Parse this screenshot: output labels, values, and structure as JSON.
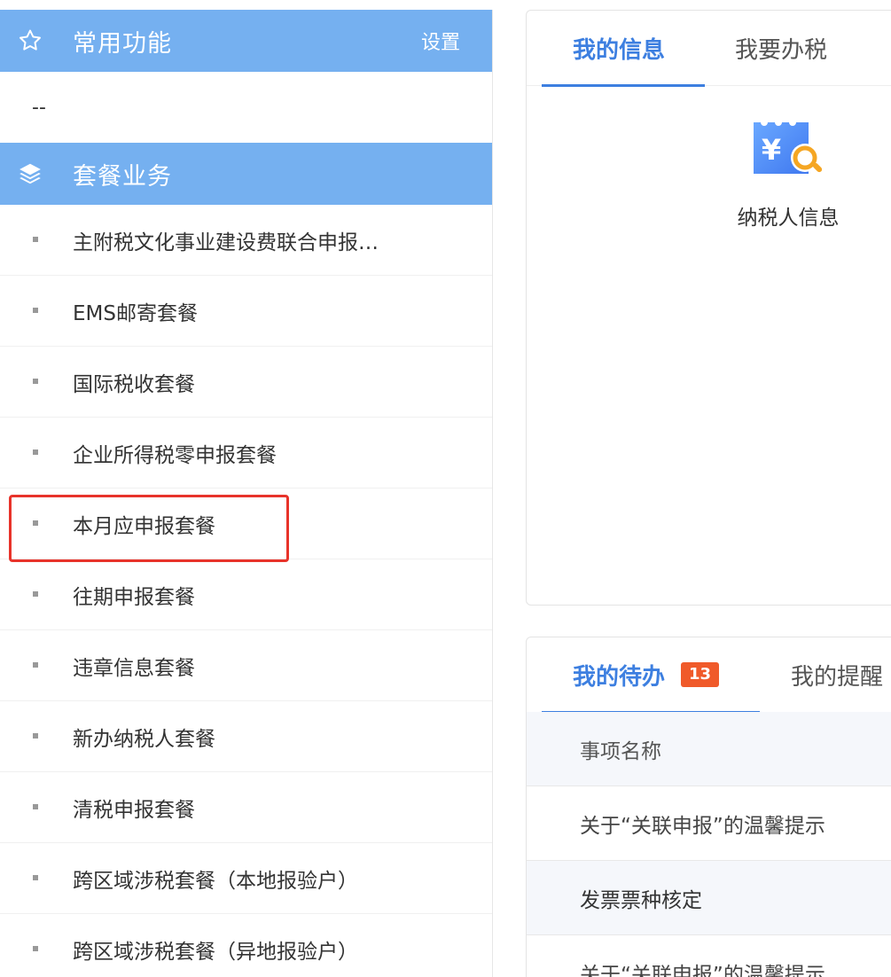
{
  "sidebar": {
    "favorites": {
      "title": "常用功能",
      "settings_label": "设置",
      "empty_text": "--"
    },
    "packages": {
      "title": "套餐业务",
      "items": [
        {
          "label": "主附税文化事业建设费联合申报…"
        },
        {
          "label": "EMS邮寄套餐"
        },
        {
          "label": "国际税收套餐"
        },
        {
          "label": "企业所得税零申报套餐"
        },
        {
          "label": "本月应申报套餐"
        },
        {
          "label": "往期申报套餐"
        },
        {
          "label": "违章信息套餐"
        },
        {
          "label": "新办纳税人套餐"
        },
        {
          "label": "清税申报套餐"
        },
        {
          "label": "跨区域涉税套餐（本地报验户）"
        },
        {
          "label": "跨区域涉税套餐（异地报验户）"
        }
      ]
    }
  },
  "info_panel": {
    "tabs": [
      {
        "label": "我的信息",
        "active": true
      },
      {
        "label": "我要办税",
        "active": false
      }
    ],
    "tile": {
      "label": "纳税人信息",
      "icon": "taxpayer-info-icon"
    }
  },
  "todo_panel": {
    "tabs": [
      {
        "label": "我的待办",
        "badge": "13",
        "active": true
      },
      {
        "label": "我的提醒",
        "active": false
      }
    ],
    "table": {
      "header": "事项名称",
      "rows": [
        "关于“关联申报”的温馨提示",
        "发票票种核定",
        "关于“关联申报”的温馨提示"
      ]
    }
  },
  "colors": {
    "header_blue": "#75b0f0",
    "accent_blue": "#3d7fe0",
    "badge_orange": "#f05a2a",
    "highlight_red": "#e8332a"
  }
}
